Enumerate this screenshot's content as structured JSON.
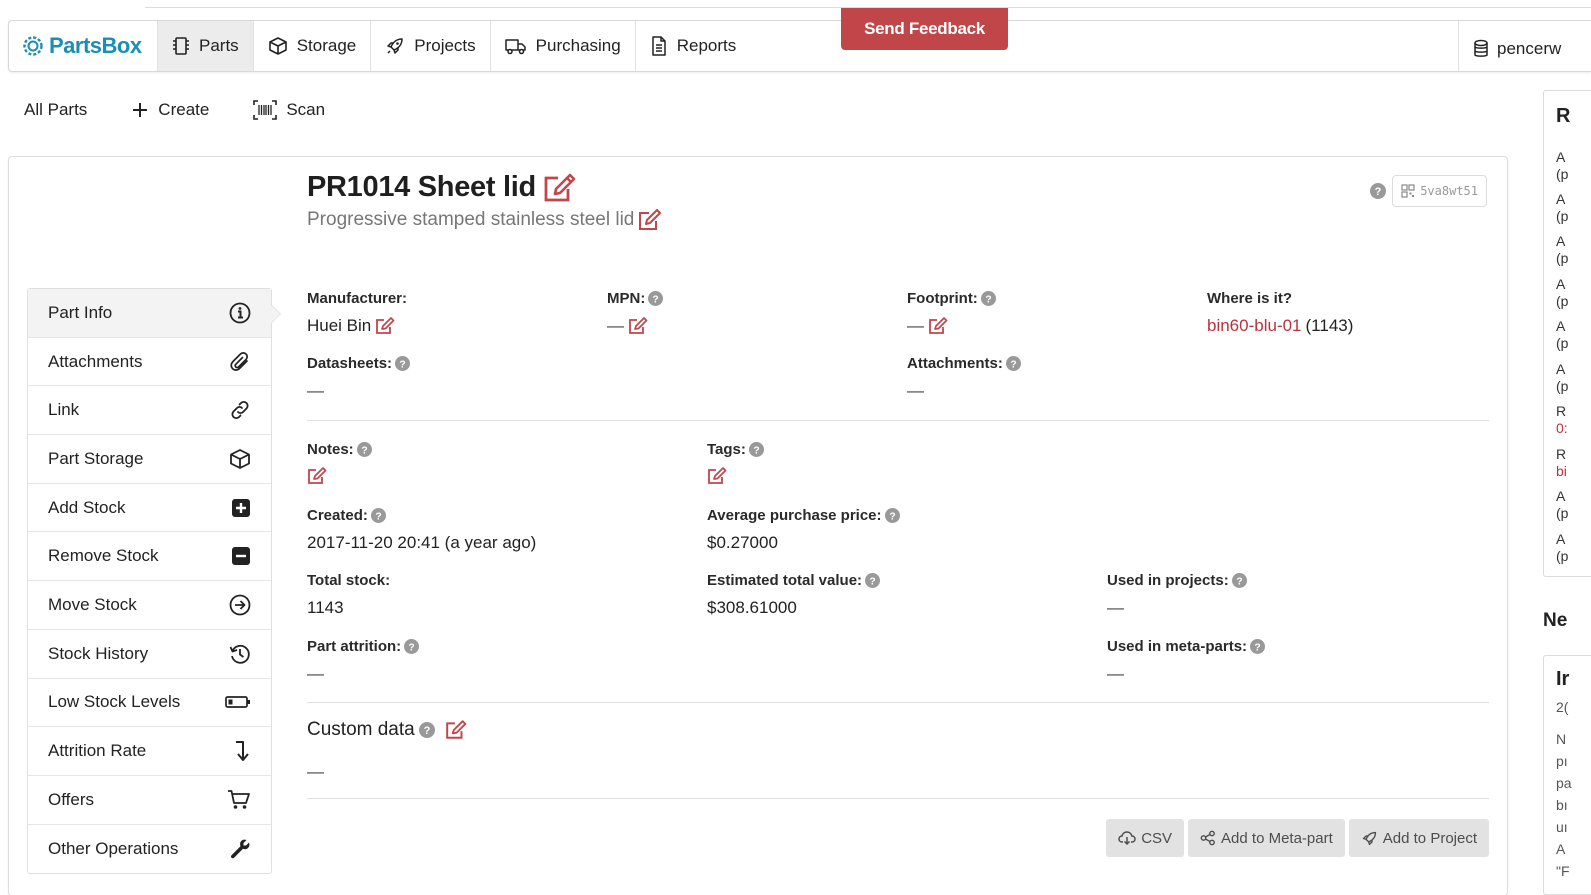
{
  "nav": {
    "brand": "PartsBox",
    "items": [
      {
        "label": "Parts",
        "icon": "chip-icon"
      },
      {
        "label": "Storage",
        "icon": "box-icon"
      },
      {
        "label": "Projects",
        "icon": "rocket-icon"
      },
      {
        "label": "Purchasing",
        "icon": "truck-icon"
      },
      {
        "label": "Reports",
        "icon": "document-icon"
      }
    ],
    "user": "pencerw",
    "feedback": "Send Feedback"
  },
  "subnav": {
    "all_parts": "All Parts",
    "create": "Create",
    "scan": "Scan"
  },
  "part": {
    "title": "PR1014 Sheet lid",
    "description": "Progressive stamped stainless steel lid",
    "id_code": "5va8wt51"
  },
  "side_menu": [
    {
      "label": "Part Info",
      "icon": "info-icon"
    },
    {
      "label": "Attachments",
      "icon": "paperclip-icon"
    },
    {
      "label": "Link",
      "icon": "link-icon"
    },
    {
      "label": "Part Storage",
      "icon": "box-icon"
    },
    {
      "label": "Add Stock",
      "icon": "plus-square-icon"
    },
    {
      "label": "Remove Stock",
      "icon": "minus-square-icon"
    },
    {
      "label": "Move Stock",
      "icon": "arrow-circle-icon"
    },
    {
      "label": "Stock History",
      "icon": "history-icon"
    },
    {
      "label": "Low Stock Levels",
      "icon": "battery-icon"
    },
    {
      "label": "Attrition Rate",
      "icon": "down-arrow-icon"
    },
    {
      "label": "Offers",
      "icon": "cart-icon"
    },
    {
      "label": "Other Operations",
      "icon": "wrench-icon"
    }
  ],
  "fields": {
    "manufacturer": {
      "label": "Manufacturer:",
      "value": "Huei Bin"
    },
    "mpn": {
      "label": "MPN:",
      "value": "—"
    },
    "footprint": {
      "label": "Footprint:",
      "value": "—"
    },
    "where": {
      "label": "Where is it?",
      "location": "bin60-blu-01",
      "count": "(1143)"
    },
    "datasheets": {
      "label": "Datasheets:",
      "value": "—"
    },
    "attachments": {
      "label": "Attachments:",
      "value": "—"
    },
    "notes": {
      "label": "Notes:"
    },
    "tags": {
      "label": "Tags:"
    },
    "created": {
      "label": "Created:",
      "value": "2017-11-20 20:41 (a year ago)"
    },
    "avg_price": {
      "label": "Average purchase price:",
      "value": "$0.27000"
    },
    "total_stock": {
      "label": "Total stock:",
      "value": "1143"
    },
    "est_value": {
      "label": "Estimated total value:",
      "value": "$308.61000"
    },
    "used_projects": {
      "label": "Used in projects:",
      "value": "—"
    },
    "attrition": {
      "label": "Part attrition:",
      "value": "—"
    },
    "used_meta": {
      "label": "Used in meta-parts:",
      "value": "—"
    },
    "custom_data": {
      "label": "Custom data",
      "value": "—"
    }
  },
  "actions": {
    "csv": "CSV",
    "meta": "Add to Meta-part",
    "project": "Add to Project"
  },
  "right_panel": {
    "heading": "R",
    "lines": [
      "A",
      "(p",
      "A",
      "(p",
      "A",
      "(p",
      "A",
      "(p",
      "A",
      "(p",
      "A",
      "(p",
      "R",
      "0:",
      "R",
      "bi",
      "A",
      "(p",
      "A",
      "(p"
    ],
    "new_heading": "Ne",
    "card_heading": "Ir",
    "card_lines": [
      "2(",
      "N",
      "pı",
      "pa",
      "bı",
      "uı",
      "A",
      "\"F"
    ]
  },
  "colors": {
    "brand": "#1a8fb3",
    "accent_red": "#c0464a",
    "link_red": "#b8343c"
  }
}
